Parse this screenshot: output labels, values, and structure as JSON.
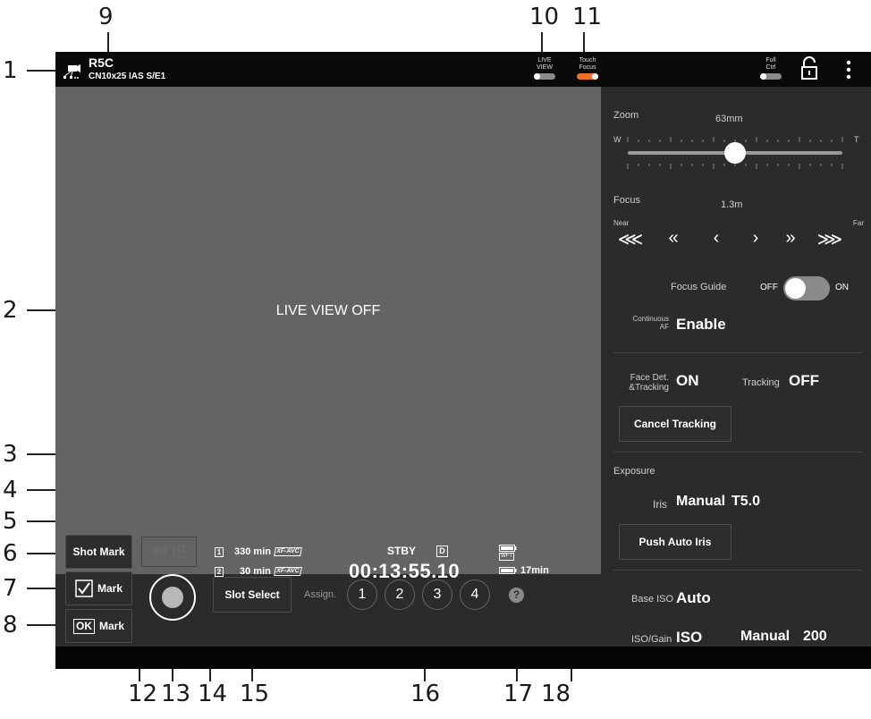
{
  "callouts": [
    "1",
    "2",
    "3",
    "4",
    "5",
    "6",
    "7",
    "8",
    "9",
    "10",
    "11",
    "12",
    "13",
    "14",
    "15",
    "16",
    "17",
    "18"
  ],
  "topbar": {
    "camera_name": "R5C",
    "lens_name": "CN10x25 IAS S/E1",
    "live_view_label": "LIVE\nVIEW",
    "live_view_on": false,
    "touch_focus_label": "Touch\nFocus",
    "touch_focus_on": true,
    "full_ctrl_label": "Full\nCtrl",
    "full_ctrl_on": false,
    "lock_icon": "unlock-icon",
    "menu_icon": "more-vertical-icon"
  },
  "liveview": {
    "status_text": "LIVE VIEW OFF"
  },
  "right_panel": {
    "zoom": {
      "label": "Zoom",
      "value": "63mm",
      "wide_label": "W",
      "tele_label": "T",
      "position": 0.5
    },
    "focus": {
      "label": "Focus",
      "value": "1.3m",
      "near_label": "Near",
      "far_label": "Far",
      "buttons": [
        "⋘",
        "«",
        "‹",
        "›",
        "»",
        "⋙"
      ]
    },
    "focus_guide": {
      "label": "Focus Guide",
      "off_label": "OFF",
      "on_label": "ON",
      "state": "off"
    },
    "continuous_af": {
      "label_line1": "Continuous",
      "label_line2": "AF",
      "value": "Enable"
    },
    "face_det": {
      "label_line1": "Face Det.",
      "label_line2": "&Tracking",
      "value": "ON"
    },
    "tracking": {
      "label": "Tracking",
      "value": "OFF"
    },
    "cancel_tracking_label": "Cancel Tracking",
    "exposure_header": "Exposure",
    "iris": {
      "label": "Iris",
      "mode": "Manual",
      "value": "T5.0"
    },
    "push_auto_iris_label": "Push Auto Iris",
    "base_iso": {
      "label": "Base ISO",
      "value": "Auto"
    },
    "iso_gain": {
      "label": "ISO/Gain",
      "type": "ISO",
      "mode": "Manual",
      "value": "200"
    }
  },
  "bottom": {
    "shot_mark_label": "Shot Mark",
    "check_mark_label": "Mark",
    "ok_glyph": "OK",
    "ok_mark_label": "Mark",
    "ip_label": "IP",
    "slot1": {
      "number": "1",
      "remaining": "330 min",
      "format": "XF-AVC"
    },
    "slot2": {
      "number": "2",
      "remaining": "30 min",
      "format": "XF-AVC"
    },
    "status": "STBY",
    "timecode": "00:13:55.10",
    "drop_frame_glyph": "D",
    "wft_label": "WFT",
    "battery_time": "17min",
    "slot_select_label": "Slot Select",
    "assign_label": "Assign.",
    "assign_buttons": [
      "1",
      "2",
      "3",
      "4"
    ],
    "help_glyph": "?"
  },
  "colors": {
    "accent": "#f07028",
    "panel": "#2b2b2b",
    "liveview": "#646464",
    "topbar": "#0a0a0a"
  }
}
